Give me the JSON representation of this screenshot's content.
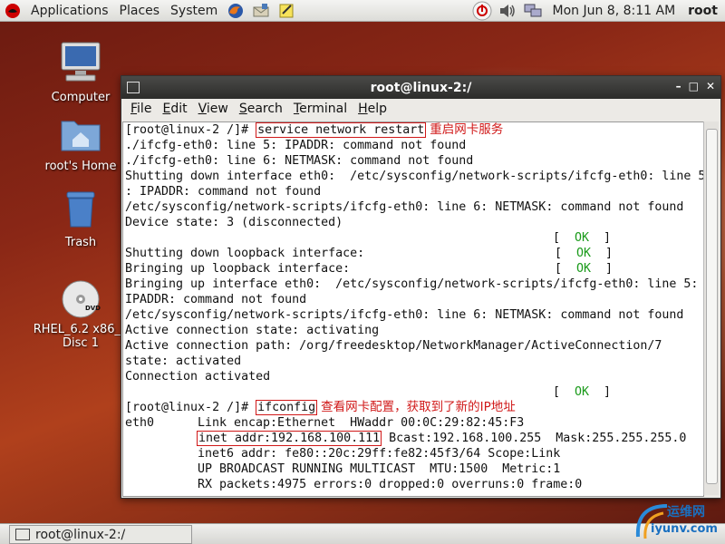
{
  "panel": {
    "menus": [
      "Applications",
      "Places",
      "System"
    ],
    "clock": "Mon Jun  8,  8:11 AM",
    "user": "root"
  },
  "desktop": {
    "icons": [
      {
        "label": "Computer"
      },
      {
        "label": "root's Home"
      },
      {
        "label": "Trash"
      },
      {
        "label": "RHEL_6.2 x86_6",
        "label2": "Disc 1",
        "badge": "DVD"
      }
    ]
  },
  "window": {
    "title": "root@linux-2:/",
    "menu": [
      "File",
      "Edit",
      "View",
      "Search",
      "Terminal",
      "Help"
    ]
  },
  "terminal": {
    "prompt": "[root@linux-2 /]# ",
    "cmd1": "service network restart",
    "note1": "重启网卡服务",
    "lines_a": [
      "./ifcfg-eth0: line 5: IPADDR: command not found",
      "./ifcfg-eth0: line 6: NETMASK: command not found",
      "Shutting down interface eth0:  /etc/sysconfig/network-scripts/ifcfg-eth0: line 5",
      ": IPADDR: command not found",
      "/etc/sysconfig/network-scripts/ifcfg-eth0: line 6: NETMASK: command not found",
      "Device state: 3 (disconnected)"
    ],
    "ok_text": "OK",
    "loopback_down": "Shutting down loopback interface:",
    "loopback_up": "Bringing up loopback interface:",
    "lines_b": [
      "Bringing up interface eth0:  /etc/sysconfig/network-scripts/ifcfg-eth0: line 5:",
      "IPADDR: command not found",
      "/etc/sysconfig/network-scripts/ifcfg-eth0: line 6: NETMASK: command not found",
      "Active connection state: activating",
      "Active connection path: /org/freedesktop/NetworkManager/ActiveConnection/7",
      "state: activated",
      "Connection activated"
    ],
    "cmd2": "ifconfig",
    "note2": "查看网卡配置，获取到了新的IP地址",
    "if_name": "eth0",
    "if_l1": "Link encap:Ethernet  HWaddr 00:0C:29:82:45:F3",
    "if_inet": "inet addr:192.168.100.111",
    "if_l2_rest": "Bcast:192.168.100.255  Mask:255.255.255.0",
    "if_l3": "inet6 addr: fe80::20c:29ff:fe82:45f3/64 Scope:Link",
    "if_l4": "UP BROADCAST RUNNING MULTICAST  MTU:1500  Metric:1",
    "if_l5": "RX packets:4975 errors:0 dropped:0 overruns:0 frame:0"
  },
  "taskbar": {
    "item": "root@linux-2:/"
  },
  "watermark": {
    "cn": "运维网",
    "url": "iyunv.com"
  }
}
